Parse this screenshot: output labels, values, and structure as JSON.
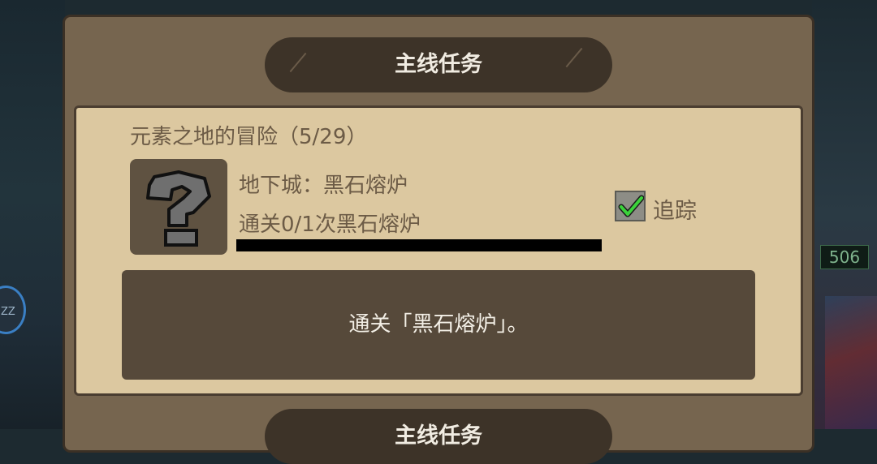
{
  "panel": {
    "title": "主线任务",
    "next_title": "主线任务"
  },
  "quest": {
    "chain_title": "元素之地的冒险（5/29）",
    "icon": "question-mark-icon",
    "dungeon_label": "地下城：黑石熔炉",
    "progress_text": "通关0/1次黑石熔炉",
    "progress_fraction": 0,
    "track_label": "追踪",
    "track_checked": true,
    "description": "通关「黑石熔炉」。"
  },
  "background": {
    "left_badge_text": "ZZ",
    "right_counter": "506"
  }
}
